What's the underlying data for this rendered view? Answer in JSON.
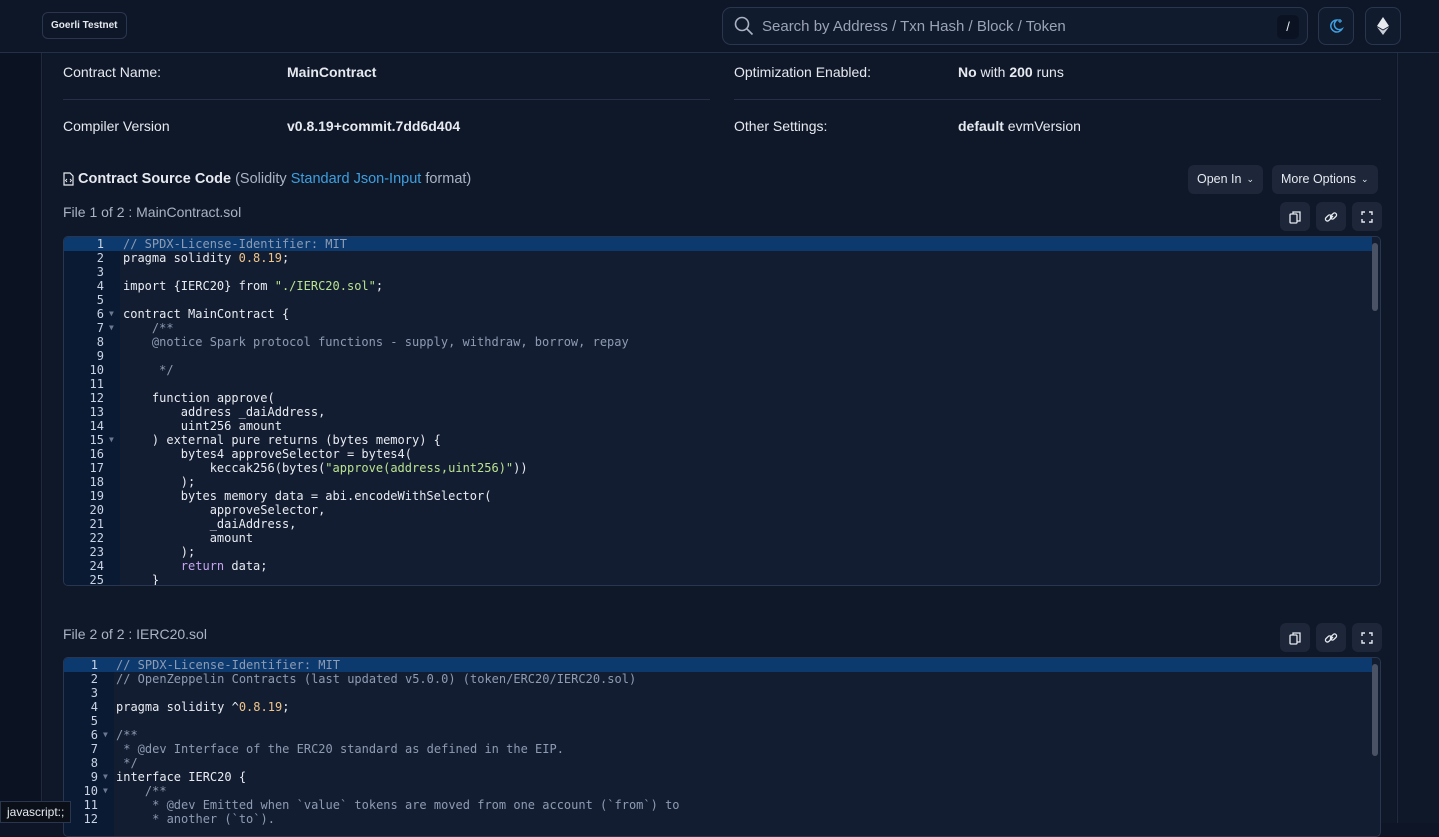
{
  "header": {
    "network": "Goerli Testnet",
    "search_placeholder": "Search by Address / Txn Hash / Block / Token",
    "search_shortcut": "/",
    "theme_icon": "moon-icon",
    "network_icon": "ethereum-icon"
  },
  "info": {
    "contract_name_label": "Contract Name:",
    "contract_name": "MainContract",
    "compiler_label": "Compiler Version",
    "compiler": "v0.8.19+commit.7dd6d404",
    "optimization_label": "Optimization Enabled:",
    "optimization_no": "No",
    "optimization_with": " with ",
    "optimization_runs": "200",
    "optimization_runs_suffix": " runs",
    "other_label": "Other Settings:",
    "other_default": "default",
    "other_suffix": " evmVersion"
  },
  "source": {
    "title": "Contract Source Code",
    "paren_open": "(Solidity ",
    "link": "Standard Json-Input",
    "paren_close": " format)",
    "open_in": "Open In",
    "more_options": "More Options"
  },
  "colors": {
    "accent": "#3ea0e0",
    "background": "#0d1526",
    "highlight": "#0d3a6e"
  },
  "files": [
    {
      "label": "File 1 of 2 : MainContract.sol",
      "folds": [
        6,
        7,
        15
      ],
      "lines": [
        [
          [
            "cm",
            "// SPDX-License-Identifier: MIT"
          ]
        ],
        [
          [
            "",
            "pragma solidity "
          ],
          [
            "num",
            "0.8.19"
          ],
          [
            "",
            ";"
          ]
        ],
        [],
        [
          [
            "",
            "import {IERC20} from "
          ],
          [
            "str",
            "\"./IERC20.sol\""
          ],
          [
            "",
            ";"
          ]
        ],
        [],
        [
          [
            "",
            "contract MainContract {"
          ]
        ],
        [
          [
            "cm",
            "    /**"
          ]
        ],
        [
          [
            "cm",
            "    @notice Spark protocol functions - supply, withdraw, borrow, repay"
          ]
        ],
        [],
        [
          [
            "cm",
            "     */"
          ]
        ],
        [],
        [
          [
            "",
            "    function approve("
          ]
        ],
        [
          [
            "",
            "        address _daiAddress,"
          ]
        ],
        [
          [
            "",
            "        uint256 amount"
          ]
        ],
        [
          [
            "",
            "    ) external pure returns (bytes memory) {"
          ]
        ],
        [
          [
            "",
            "        bytes4 approveSelector = bytes4("
          ]
        ],
        [
          [
            "",
            "            keccak256(bytes("
          ],
          [
            "str",
            "\"approve(address,uint256)\""
          ],
          [
            "",
            "))"
          ]
        ],
        [
          [
            "",
            "        );"
          ]
        ],
        [
          [
            "",
            "        bytes memory data = abi.encodeWithSelector("
          ]
        ],
        [
          [
            "",
            "            approveSelector,"
          ]
        ],
        [
          [
            "",
            "            _daiAddress,"
          ]
        ],
        [
          [
            "",
            "            amount"
          ]
        ],
        [
          [
            "",
            "        );"
          ]
        ],
        [
          [
            "kw",
            "        return"
          ],
          [
            "",
            " data;"
          ]
        ],
        [
          [
            "",
            "    }"
          ]
        ]
      ]
    },
    {
      "label": "File 2 of 2 : IERC20.sol",
      "folds": [
        6,
        9,
        10
      ],
      "lines": [
        [
          [
            "cm",
            "// SPDX-License-Identifier: MIT"
          ]
        ],
        [
          [
            "cm",
            "// OpenZeppelin Contracts (last updated v5.0.0) (token/ERC20/IERC20.sol)"
          ]
        ],
        [],
        [
          [
            "",
            "pragma solidity ^"
          ],
          [
            "num",
            "0.8.19"
          ],
          [
            "",
            ";"
          ]
        ],
        [],
        [
          [
            "cm",
            "/**"
          ]
        ],
        [
          [
            "cm",
            " * @dev Interface of the ERC20 standard as defined in the EIP."
          ]
        ],
        [
          [
            "cm",
            " */"
          ]
        ],
        [
          [
            "",
            "interface IERC20 {"
          ]
        ],
        [
          [
            "cm",
            "    /**"
          ]
        ],
        [
          [
            "cm",
            "     * @dev Emitted when `value` tokens are moved from one account (`from`) to"
          ]
        ],
        [
          [
            "cm",
            "     * another (`to`)."
          ]
        ]
      ]
    }
  ],
  "status_bar": "javascript:;"
}
